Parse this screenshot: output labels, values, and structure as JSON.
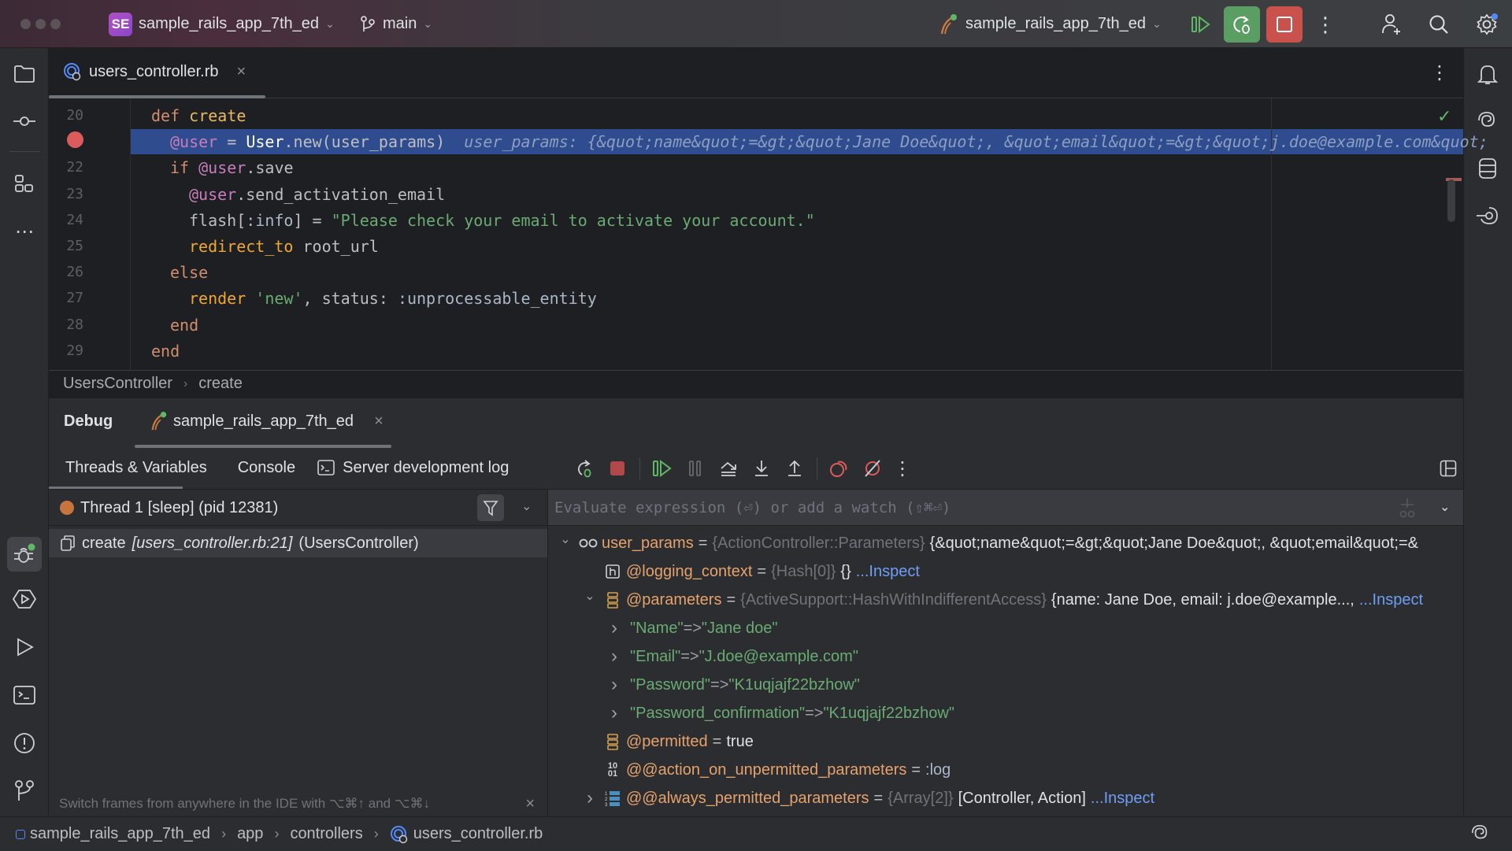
{
  "titlebar": {
    "project_badge": "SE",
    "project_name": "sample_rails_app_7th_ed",
    "branch": "main",
    "run_config": "sample_rails_app_7th_ed"
  },
  "editor": {
    "tab_label": "users_controller.rb",
    "lines": [
      {
        "num": "20",
        "tokens": [
          {
            "t": "def ",
            "c": "k-def"
          },
          {
            "t": "create",
            "c": "k-fn"
          }
        ],
        "indent": 0
      },
      {
        "num": "",
        "breakpoint": true,
        "tokens": [
          {
            "t": "@user",
            "c": "k-ivar"
          },
          {
            "t": " = ",
            "c": "k-plain"
          },
          {
            "t": "User",
            "c": "k-const"
          },
          {
            "t": ".new(user_params)",
            "c": "k-plain"
          },
          {
            "t": "  user_params: {&quot;name&quot;=&gt;&quot;Jane Doe&quot;, &quot;email&quot;=&gt;&quot;j.doe@example.com&quot;",
            "c": "k-hint"
          }
        ],
        "indent": 1
      },
      {
        "num": "22",
        "tokens": [
          {
            "t": "if ",
            "c": "k-def"
          },
          {
            "t": "@user",
            "c": "k-ivar"
          },
          {
            "t": ".save",
            "c": "k-plain"
          }
        ],
        "indent": 1
      },
      {
        "num": "23",
        "tokens": [
          {
            "t": "@user",
            "c": "k-ivar"
          },
          {
            "t": ".send_activation_email",
            "c": "k-plain"
          }
        ],
        "indent": 2
      },
      {
        "num": "24",
        "tokens": [
          {
            "t": "flash[",
            "c": "k-plain"
          },
          {
            "t": ":info",
            "c": "k-sym"
          },
          {
            "t": "] = ",
            "c": "k-plain"
          },
          {
            "t": "\"Please check your email to activate your account.\"",
            "c": "k-str"
          }
        ],
        "indent": 2
      },
      {
        "num": "25",
        "tokens": [
          {
            "t": "redirect_to",
            "c": "k-call"
          },
          {
            "t": " root_url",
            "c": "k-plain"
          }
        ],
        "indent": 2
      },
      {
        "num": "26",
        "tokens": [
          {
            "t": "else",
            "c": "k-def"
          }
        ],
        "indent": 1
      },
      {
        "num": "27",
        "tokens": [
          {
            "t": "render",
            "c": "k-call"
          },
          {
            "t": " ",
            "c": "k-plain"
          },
          {
            "t": "'new'",
            "c": "k-str"
          },
          {
            "t": ", status: ",
            "c": "k-plain"
          },
          {
            "t": ":unprocessable_entity",
            "c": "k-sym"
          }
        ],
        "indent": 2
      },
      {
        "num": "28",
        "tokens": [
          {
            "t": "end",
            "c": "k-def"
          }
        ],
        "indent": 1
      },
      {
        "num": "29",
        "tokens": [
          {
            "t": "end",
            "c": "k-def"
          }
        ],
        "indent": 0
      }
    ],
    "breadcrumb": [
      "UsersController",
      "create"
    ]
  },
  "debug": {
    "title": "Debug",
    "session_tab": "sample_rails_app_7th_ed",
    "subtabs": [
      "Threads & Variables",
      "Console",
      "Server development log"
    ],
    "thread_label": "Thread 1 [sleep] (pid 12381)",
    "frame": {
      "method": "create",
      "location": "[users_controller.rb:21]",
      "class": "(UsersController)"
    },
    "frames_hint": "Switch frames from anywhere in the IDE with ⌥⌘↑ and ⌥⌘↓",
    "eval_placeholder": "Evaluate expression (⏎) or add a watch (⇧⌘⏎)",
    "variables": [
      {
        "level": 0,
        "toggle": "expanded",
        "icon": "watch",
        "name": "user_params",
        "type": "{ActionController::Parameters}",
        "value": "{&quot;name&quot;=&gt;&quot;Jane Doe&quot;, &quot;email&quot;=&"
      },
      {
        "level": 1,
        "toggle": "none",
        "icon": "hash",
        "name": "@logging_context",
        "type": "{Hash[0]}",
        "value": "{}",
        "link": "...Inspect"
      },
      {
        "level": 1,
        "toggle": "expanded",
        "icon": "object",
        "name": "@parameters",
        "type": "{ActiveSupport::HashWithIndifferentAccess}",
        "value": "{name: Jane Doe, email: j.doe@example...,",
        "link": "...Inspect"
      },
      {
        "level": 2,
        "toggle": "collapsed",
        "icon": "none",
        "key": "\"Name\"",
        "arrow": "=>",
        "strval": "\"Jane doe\""
      },
      {
        "level": 2,
        "toggle": "collapsed",
        "icon": "none",
        "key": "\"Email\"",
        "arrow": "=>",
        "strval": "\"J.doe@example.com\""
      },
      {
        "level": 2,
        "toggle": "collapsed",
        "icon": "none",
        "key": "\"Password\"",
        "arrow": "=>",
        "strval": "\"K1uqjajf22bzhow\""
      },
      {
        "level": 2,
        "toggle": "collapsed",
        "icon": "none",
        "key": "\"Password_confirmation\"",
        "arrow": "=>",
        "strval": "\"K1uqjajf22bzhow\""
      },
      {
        "level": 1,
        "toggle": "none",
        "icon": "object",
        "name": "@permitted",
        "type": "",
        "value": "true"
      },
      {
        "level": 1,
        "toggle": "none",
        "icon": "binary",
        "name": "@@action_on_unpermitted_parameters",
        "type": "",
        "symval": ":log"
      },
      {
        "level": 1,
        "toggle": "collapsed",
        "icon": "array",
        "name": "@@always_permitted_parameters",
        "type": "{Array[2]}",
        "value": "[Controller, Action]",
        "link": "...Inspect"
      }
    ]
  },
  "statusbar": {
    "path": [
      "sample_rails_app_7th_ed",
      "app",
      "controllers",
      "users_controller.rb"
    ]
  },
  "colors": {
    "accent_blue": "#2f4d8e",
    "debug_green": "#5b9e63",
    "stop_red": "#c9524d",
    "breakpoint": "#db5c5c",
    "link": "#6e9ef5"
  }
}
